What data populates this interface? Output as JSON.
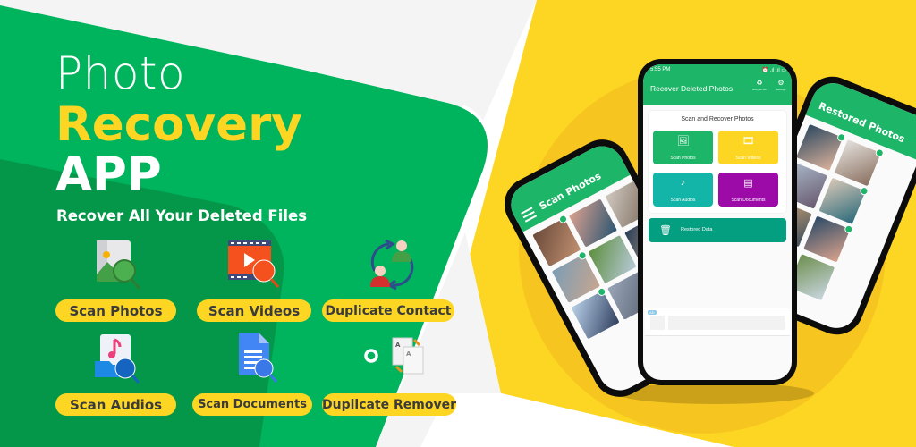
{
  "banner": {
    "headline_line1": "Photo",
    "headline_line2": "Recovery",
    "headline_line3": "APP",
    "tagline": "Recover All Your Deleted Files",
    "colors": {
      "green": "#00b45e",
      "dark_green": "#059749",
      "yellow": "#fdd623",
      "yellow_circle": "#f7c51f",
      "pill_text": "#3b3b3b"
    }
  },
  "features": [
    {
      "label": "Scan Photos",
      "icon": "photo-search-icon"
    },
    {
      "label": "Scan Videos",
      "icon": "video-search-icon"
    },
    {
      "label": "Duplicate Contact",
      "icon": "contact-sync-icon"
    },
    {
      "label": "Scan Audios",
      "icon": "audio-search-icon"
    },
    {
      "label": "Scan Documents",
      "icon": "document-search-icon"
    },
    {
      "label": "Duplicate Remover",
      "icon": "duplicate-docs-icon"
    }
  ],
  "main_phone": {
    "status_time": "5:55 PM",
    "status_icons": "⏰ .ıl .ıl ▭",
    "app_title": "Recover Deleted Photos",
    "actions": [
      {
        "label": "Recycle Bin",
        "icon": "recycle-bin-icon"
      },
      {
        "label": "Settings",
        "icon": "gear-icon"
      }
    ],
    "card_title": "Scan and Recover Photos",
    "tiles": [
      {
        "label": "Scan Photos",
        "color": "#1db567"
      },
      {
        "label": "Scan Videos",
        "color": "#fdd623"
      },
      {
        "label": "Scan Audios",
        "color": "#13b5a8"
      },
      {
        "label": "Scan Documents",
        "color": "#9c0aa8"
      }
    ],
    "restored_label": "Restored Data",
    "ad_badge": "AD"
  },
  "left_phone": {
    "title": "Scan Photos"
  },
  "right_phone": {
    "title": "Restored Photos"
  }
}
